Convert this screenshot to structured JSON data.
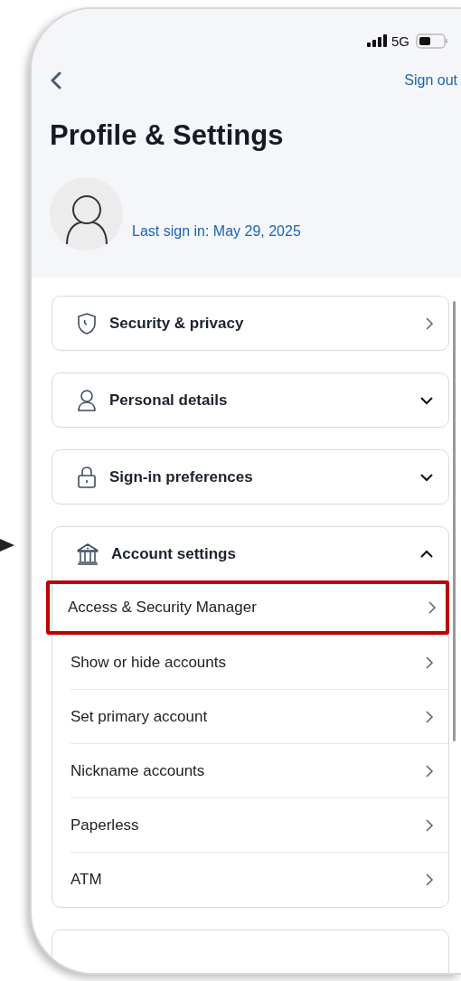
{
  "status_bar": {
    "network": "5G"
  },
  "header": {
    "sign_out": "Sign out",
    "title": "Profile & Settings",
    "last_sign_in": "Last sign in: May 29, 2025"
  },
  "sections": [
    {
      "label": "Security & privacy",
      "kind": "link"
    },
    {
      "label": "Personal details",
      "kind": "accordion",
      "expanded": false
    },
    {
      "label": "Sign-in preferences",
      "kind": "accordion",
      "expanded": false
    },
    {
      "label": "Account settings",
      "kind": "accordion",
      "expanded": true,
      "items": [
        {
          "label": "Access & Security Manager",
          "highlighted": true
        },
        {
          "label": "Show or hide accounts",
          "highlighted": false
        },
        {
          "label": "Set primary account",
          "highlighted": false
        },
        {
          "label": "Nickname accounts",
          "highlighted": false
        },
        {
          "label": "Paperless",
          "highlighted": false
        },
        {
          "label": "ATM",
          "highlighted": false
        }
      ]
    }
  ]
}
